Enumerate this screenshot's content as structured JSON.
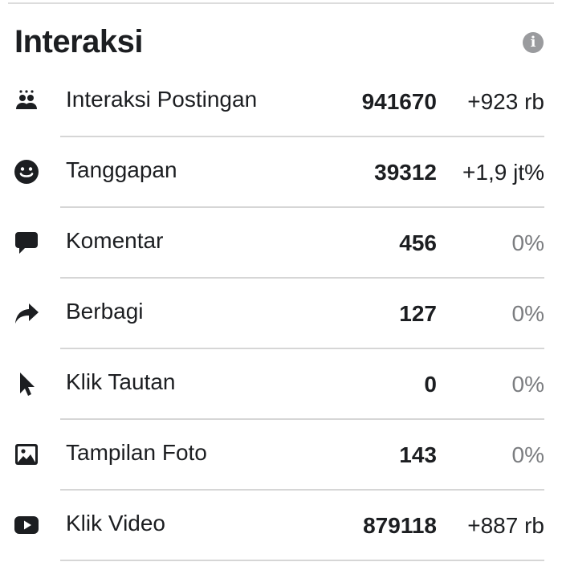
{
  "header": {
    "title": "Interaksi",
    "info_icon": "info-icon"
  },
  "rows": [
    {
      "icon": "group-icon",
      "label": "Interaksi Postingan",
      "value": "941670",
      "change": "+923 rb"
    },
    {
      "icon": "smiley-icon",
      "label": "Tanggapan",
      "value": "39312",
      "change": "+1,9 jt%"
    },
    {
      "icon": "comment-icon",
      "label": "Komentar",
      "value": "456",
      "change": "0%"
    },
    {
      "icon": "share-icon",
      "label": "Berbagi",
      "value": "127",
      "change": "0%"
    },
    {
      "icon": "cursor-icon",
      "label": "Klik Tautan",
      "value": "0",
      "change": "0%"
    },
    {
      "icon": "photo-icon",
      "label": "Tampilan Foto",
      "value": "143",
      "change": "0%"
    },
    {
      "icon": "video-icon",
      "label": "Klik Video",
      "value": "879118",
      "change": "+887 rb"
    }
  ],
  "colors": {
    "text": "#1c1e21",
    "muted": "#7b7d80",
    "divider": "#d6d6d6",
    "info_bg": "#9a9b9e"
  }
}
